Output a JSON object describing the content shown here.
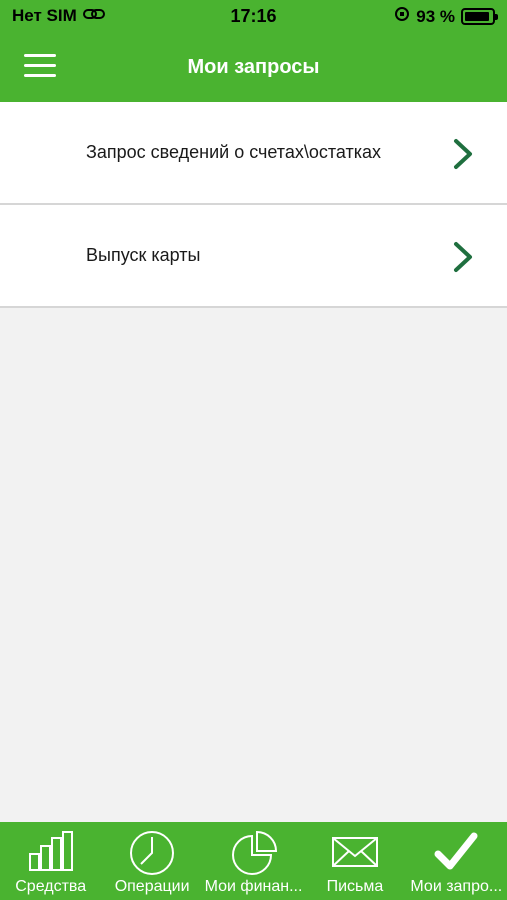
{
  "status_bar": {
    "carrier": "Нет SIM",
    "time": "17:16",
    "battery_text": "93 %",
    "battery_level": 0.93
  },
  "nav": {
    "title": "Мои запросы",
    "menu_icon": "hamburger-icon"
  },
  "requests": [
    {
      "label": "Запрос сведений о счетах\\остатках",
      "icon": "chevron-right-icon"
    },
    {
      "label": "Выпуск карты",
      "icon": "chevron-right-icon"
    }
  ],
  "tabs": [
    {
      "label": "Средства",
      "icon": "bar-chart-icon"
    },
    {
      "label": "Операции",
      "icon": "clock-icon"
    },
    {
      "label": "Мои финан...",
      "icon": "pie-chart-icon"
    },
    {
      "label": "Письма",
      "icon": "envelope-icon"
    },
    {
      "label": "Мои запро...",
      "icon": "checkmark-icon"
    }
  ],
  "colors": {
    "brand_green": "#4ab330",
    "chevron_green": "#1f6f3f",
    "background": "#f2f2f2"
  }
}
